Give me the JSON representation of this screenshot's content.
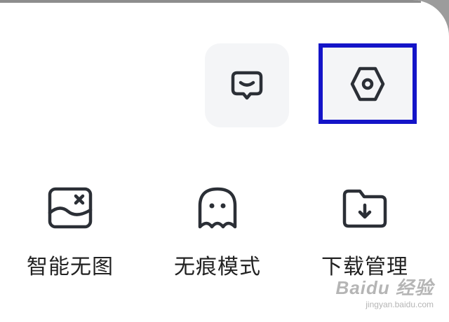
{
  "quick_actions": {
    "feedback_icon": "chat-bubble-icon",
    "settings_icon": "hex-nut-settings-icon"
  },
  "tools": [
    {
      "label": "智能无图",
      "icon": "no-image-icon"
    },
    {
      "label": "无痕模式",
      "icon": "ghost-icon"
    },
    {
      "label": "下载管理",
      "icon": "folder-download-icon"
    }
  ],
  "watermark": {
    "brand": "Baidu 经验",
    "site": "jingyan.baidu.com"
  },
  "colors": {
    "icon_stroke": "#2b2f36",
    "highlight_border": "#1414c8",
    "tile_background": "#f4f5f7"
  }
}
